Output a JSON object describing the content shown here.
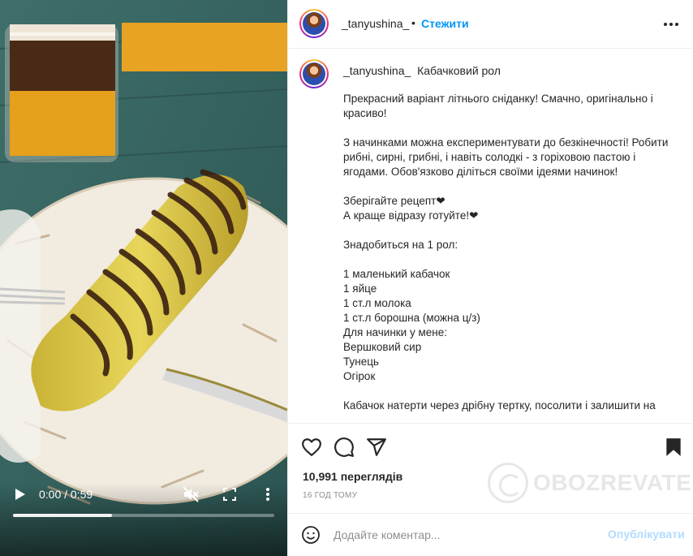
{
  "video": {
    "time": "0:00 / 0:59",
    "progress": 0.0,
    "buffered": 0.38,
    "icons": {
      "play": "play-icon",
      "mute": "muted-speaker-icon",
      "fullscreen": "fullscreen-icon",
      "more": "more-vertical-icon"
    }
  },
  "header": {
    "username": "_tanyushina_",
    "separator": "•",
    "follow_label": "Стежити",
    "options_icon": "more-horizontal-icon"
  },
  "caption": {
    "username": "_tanyushina_",
    "title": "Кабачковий рол",
    "text": "Прекрасний варіант літнього сніданку! Смачно, оригінально і красиво!\n\nЗ начинками можна експериментувати до безкінечності! Робити рибні, сирні, грибні, і навіть солодкі - з горіховою пастою і ягодами. Обов'язково діліться своїми ідеями начинок!\n\nЗберігайте рецепт❤\nА краще відразу готуйте!❤\n\nЗнадобиться на 1 рол:\n\n1 маленький кабачок\n1 яйце\n1 ст.л молока\n1 ст.л борошна (можна ц/з)\nДля начинки у мене:\nВершковий сир\nТунець\nОгірок\n\nКабачок натерти через дрібну тертку, посолити і залишити на"
  },
  "actions": {
    "icons": [
      "heart-icon",
      "comment-icon",
      "share-icon",
      "bookmark-icon"
    ],
    "views": "10,991 переглядів",
    "time_ago": "16 ГОД ТОМУ"
  },
  "watermark": {
    "text": "OBOZREVATEL"
  },
  "comment": {
    "placeholder": "Додайте коментар...",
    "post_label": "Опублікувати"
  },
  "colors": {
    "link": "#0095f6",
    "post_disabled": "#b3dbff",
    "muted": "#8e8e8e"
  }
}
